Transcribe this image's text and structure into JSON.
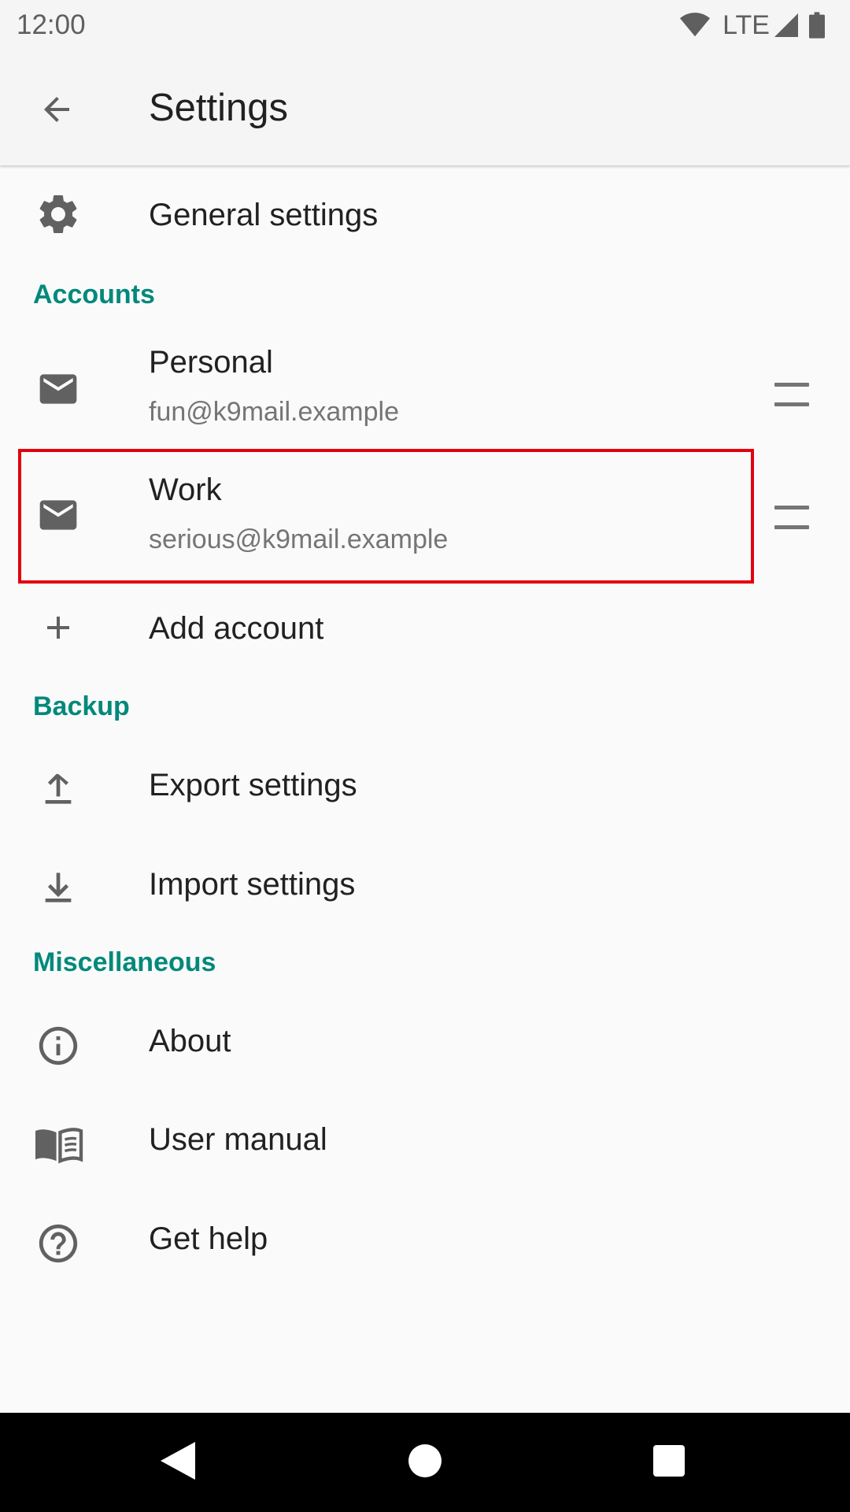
{
  "status_bar": {
    "time": "12:00",
    "network": "LTE"
  },
  "app_bar": {
    "title": "Settings",
    "back_icon": "arrow-back-icon"
  },
  "general": {
    "label": "General settings",
    "icon": "gear-icon"
  },
  "accounts": {
    "header": "Accounts",
    "items": [
      {
        "name": "Personal",
        "email": "fun@k9mail.example",
        "icon": "envelope-icon"
      },
      {
        "name": "Work",
        "email": "serious@k9mail.example",
        "icon": "envelope-icon"
      }
    ],
    "add_label": "Add account"
  },
  "backup": {
    "header": "Backup",
    "export_label": "Export settings",
    "import_label": "Import settings"
  },
  "misc": {
    "header": "Miscellaneous",
    "about_label": "About",
    "manual_label": "User manual",
    "help_label": "Get help"
  },
  "colors": {
    "accent": "#00897b",
    "highlight": "#e3000f",
    "icon": "#616161"
  }
}
